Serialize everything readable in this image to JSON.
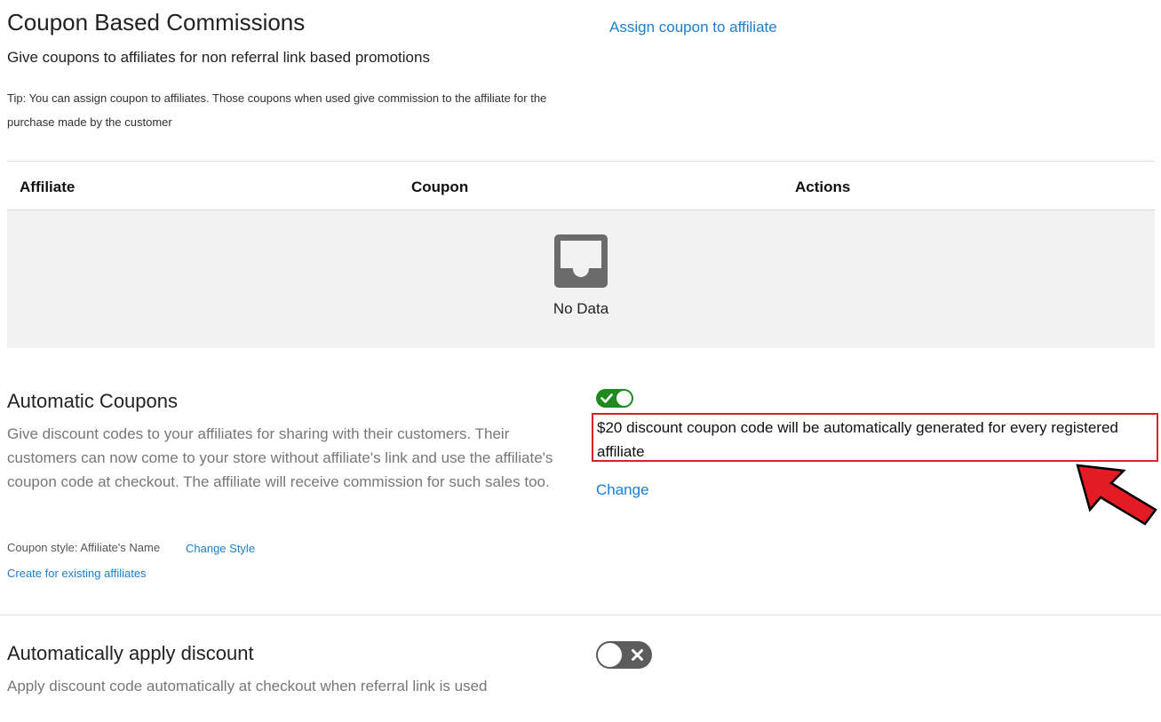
{
  "coupon_section": {
    "title": "Coupon Based Commissions",
    "subtitle": "Give coupons to affiliates for non referral link based promotions",
    "tip": "Tip: You can assign coupon to affiliates. Those coupons when used give commission to the affiliate for the purchase made by the customer",
    "assign_link": "Assign coupon to affiliate"
  },
  "table": {
    "columns": [
      "Affiliate",
      "Coupon",
      "Actions"
    ],
    "empty_text": "No Data"
  },
  "auto_coupons": {
    "title": "Automatic Coupons",
    "description": "Give discount codes to your affiliates for sharing with their customers. Their customers can now come to your store without affiliate's link and use the affiliate's coupon code at checkout. The affiliate will receive commission for such sales too.",
    "coupon_style_label": "Coupon style: Affiliate's Name",
    "change_style_link": "Change Style",
    "create_existing_link": "Create for existing affiliates",
    "toggle_on": true,
    "generated_text": "$20 discount coupon code will be automatically generated for every registered affiliate",
    "change_link": "Change"
  },
  "auto_apply": {
    "title": "Automatically apply discount",
    "description": "Apply discount code automatically at checkout when referral link is used",
    "toggle_on": false
  },
  "colors": {
    "link": "#1a7fd4",
    "toggle_on": "#1e8a1e",
    "toggle_off": "#5c5c5c",
    "highlight": "#d9222a",
    "arrow": "#e31b23"
  }
}
